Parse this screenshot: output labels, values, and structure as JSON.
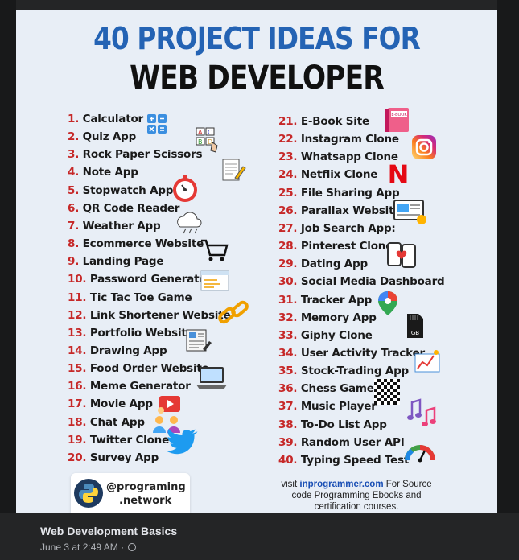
{
  "title_line1": "40 PROJECT IDEAS FOR",
  "title_line2": "WEB DEVELOPER",
  "colors": {
    "title_accent": "#2463b4",
    "number": "#c62828",
    "background": "#18191a",
    "poster_bg": "#e8eef6"
  },
  "left_items": [
    {
      "num": "1.",
      "label": "Calculator"
    },
    {
      "num": "2.",
      "label": "Quiz App"
    },
    {
      "num": "3.",
      "label": "Rock Paper Scissors"
    },
    {
      "num": "4.",
      "label": "Note App"
    },
    {
      "num": "5.",
      "label": "Stopwatch App"
    },
    {
      "num": "6.",
      "label": "QR Code Reader"
    },
    {
      "num": "7.",
      "label": "Weather App"
    },
    {
      "num": "8.",
      "label": "Ecommerce Website"
    },
    {
      "num": "9.",
      "label": "Landing Page"
    },
    {
      "num": "10.",
      "label": "Password Generator"
    },
    {
      "num": "11.",
      "label": "Tic Tac Toe Game"
    },
    {
      "num": "12.",
      "label": "Link Shortener Website"
    },
    {
      "num": "13.",
      "label": "Portfolio Website"
    },
    {
      "num": "14.",
      "label": "Drawing App"
    },
    {
      "num": "15.",
      "label": "Food Order Website"
    },
    {
      "num": "16.",
      "label": "Meme Generator"
    },
    {
      "num": "17.",
      "label": "Movie App"
    },
    {
      "num": "18.",
      "label": "Chat App"
    },
    {
      "num": "19.",
      "label": "Twitter Clone"
    },
    {
      "num": "20.",
      "label": "Survey App"
    }
  ],
  "right_items": [
    {
      "num": "21.",
      "label": "E-Book Site"
    },
    {
      "num": "22.",
      "label": "Instagram Clone"
    },
    {
      "num": "23.",
      "label": "Whatsapp Clone"
    },
    {
      "num": "24.",
      "label": "Netflix Clone"
    },
    {
      "num": "25.",
      "label": "File Sharing App"
    },
    {
      "num": "26.",
      "label": "Parallax Website"
    },
    {
      "num": "27.",
      "label": "Job Search App:"
    },
    {
      "num": "28.",
      "label": "Pinterest Clone"
    },
    {
      "num": "29.",
      "label": "Dating App"
    },
    {
      "num": "30.",
      "label": "Social Media Dashboard"
    },
    {
      "num": "31.",
      "label": "Tracker App"
    },
    {
      "num": "32.",
      "label": "Memory App"
    },
    {
      "num": "33.",
      "label": "Giphy Clone"
    },
    {
      "num": "34.",
      "label": "User Activity Tracker"
    },
    {
      "num": "35.",
      "label": "Stock-Trading App"
    },
    {
      "num": "36.",
      "label": "Chess Game"
    },
    {
      "num": "37.",
      "label": "Music Player"
    },
    {
      "num": "38.",
      "label": "To-Do List App"
    },
    {
      "num": "39.",
      "label": "Random User API"
    },
    {
      "num": "40.",
      "label": "Typing Speed Test"
    }
  ],
  "icons": {
    "ebook_label": "E-BOOK",
    "netflix_letter": "N",
    "memory_label": "GB"
  },
  "badge": {
    "handle_line1": "@programing",
    "handle_line2": ".network"
  },
  "visit": {
    "prefix": "visit ",
    "link": "inprogrammer.com",
    "suffix": " For Source code Programming Ebooks and certification courses."
  },
  "post": {
    "title": "Web Development Basics",
    "meta": "June 3 at 2:49 AM ·"
  }
}
